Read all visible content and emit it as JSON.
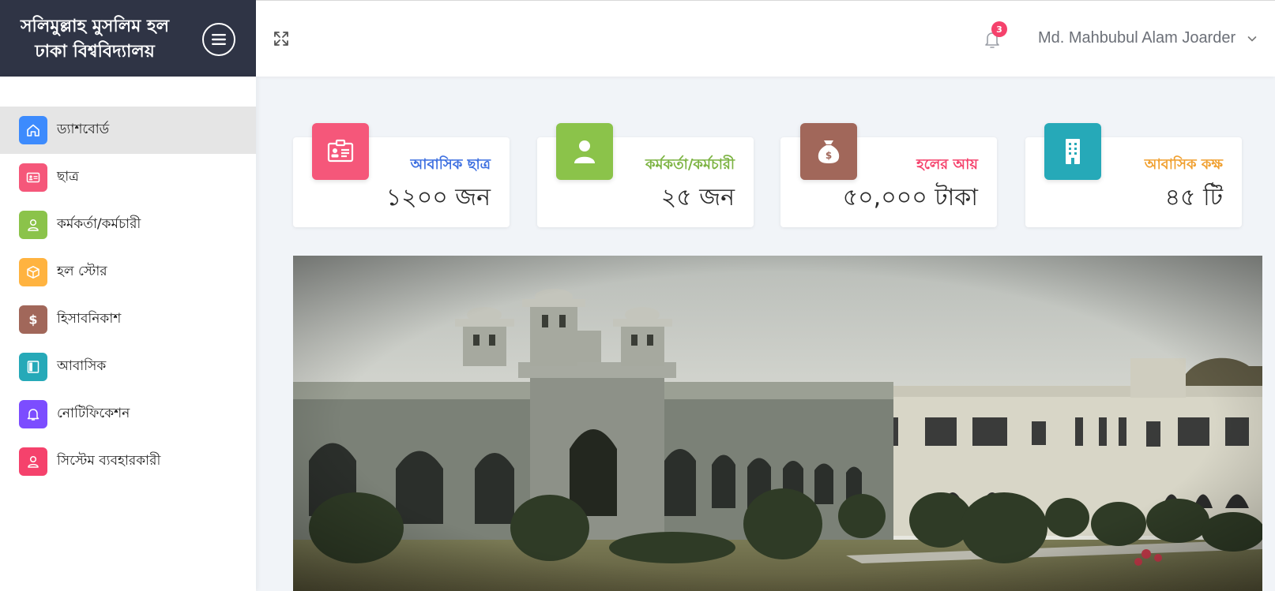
{
  "brand": {
    "title_line1": "সলিমুল্লাহ মুসলিম হল",
    "title_line2": "ঢাকা বিশ্ববিদ্যালয়"
  },
  "sidebar": {
    "items": [
      {
        "label": "ড্যাশবোর্ড",
        "icon": "home-icon",
        "color": "#3d8bfd",
        "active": true
      },
      {
        "label": "ছাত্র",
        "icon": "id-card-icon",
        "color": "#f5577a",
        "active": false
      },
      {
        "label": "কর্মকর্তা/কর্মচারী",
        "icon": "user-icon",
        "color": "#8bc34a",
        "active": false
      },
      {
        "label": "হল স্টোর",
        "icon": "box-icon",
        "color": "#ffb340",
        "active": false
      },
      {
        "label": "হিসাবনিকাশ",
        "icon": "dollar-icon",
        "color": "#a1675a",
        "active": false
      },
      {
        "label": "আবাসিক",
        "icon": "book-icon",
        "color": "#26a9b8",
        "active": false
      },
      {
        "label": "নোটিফিকেশন",
        "icon": "bell-icon",
        "color": "#7c4dff",
        "active": false
      },
      {
        "label": "সিস্টেম ব্যবহারকারী",
        "icon": "user-icon",
        "color": "#f5426c",
        "active": false
      }
    ]
  },
  "header": {
    "notification_count": "3",
    "user_name": "Md. Mahbubul Alam Joarder"
  },
  "stats": [
    {
      "label": "আবাসিক ছাত্র",
      "value": "১২০০ জন",
      "icon": "id-card-icon",
      "color": "#f5577a",
      "label_color": "#3d6fe0"
    },
    {
      "label": "কর্মকর্তা/কর্মচারী",
      "value": "২৫ জন",
      "icon": "user-icon",
      "color": "#8bc34a",
      "label_color": "#7cb342"
    },
    {
      "label": "হলের আয়",
      "value": "৫০,০০০ টাকা",
      "icon": "money-bag-icon",
      "color": "#a1675a",
      "label_color": "#f5426c"
    },
    {
      "label": "আবাসিক কক্ষ",
      "value": "৪৫ টি",
      "icon": "building-icon",
      "color": "#26a9b8",
      "label_color": "#f0a030"
    }
  ],
  "colors": {
    "sidebar_dark": "#2f3445",
    "background": "#f1f4f8",
    "badge": "#f5426c"
  }
}
